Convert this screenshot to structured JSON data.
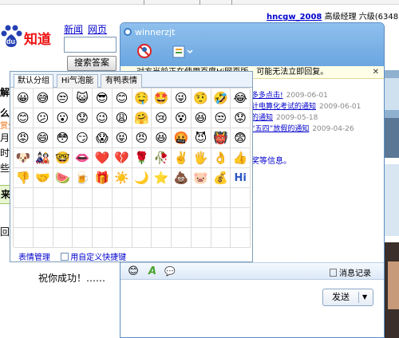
{
  "browser": {
    "user_link": "hncgw_2008",
    "user_rank": "高级经理 六级(6348)"
  },
  "baidu": {
    "logo_text": "知道",
    "nav": [
      "新闻",
      "网页"
    ],
    "search_button": "搜索答案",
    "fragments": {
      "f1": "解",
      "f2": "么",
      "f3": "赏分",
      "f4": "月百",
      "f5": "时候",
      "f6": "些给",
      "f7": "来",
      "f8": "回答"
    }
  },
  "picker": {
    "tabs": [
      "默认分组",
      "Hi气泡能",
      "有鸭表情"
    ],
    "emoticons": [
      [
        "😀",
        "😅",
        "😒",
        "😺",
        "😎",
        "😊",
        "🤤",
        "🤩",
        "😜",
        "🤨",
        "🤣",
        "😂"
      ],
      [
        "😊",
        "😕",
        "😮",
        "😟",
        "😉",
        "😩",
        "🤗",
        "😢",
        "😵",
        "😆",
        "😒",
        "😟"
      ],
      [
        "😡",
        "😄",
        "😳",
        "😏",
        "😱",
        "😝",
        "😠",
        "😆",
        "🤬",
        "😈",
        "👹",
        "😨"
      ],
      [
        "🐶",
        "🎎",
        "🤓",
        "👄",
        "❤️",
        "💔",
        "🌹",
        "🥀",
        "✌️",
        "🖐",
        "👌",
        "👍"
      ],
      [
        "👎",
        "🤝",
        "🍉",
        "🍺",
        "🎁",
        "☀️",
        "🌙",
        "⭐",
        "💩",
        "🐷",
        "💰",
        "Hi"
      ],
      [
        "",
        "",
        "",
        "",
        "",
        "",
        "",
        "",
        "",
        "",
        "",
        ""
      ],
      [
        "",
        "",
        "",
        "",
        "",
        "",
        "",
        "",
        "",
        "",
        "",
        ""
      ],
      [
        "",
        "",
        "",
        "",
        "",
        "",
        "",
        "",
        "",
        "",
        "",
        ""
      ]
    ],
    "footer": {
      "manage": "表情管理",
      "custom": "用自定义快捷键"
    }
  },
  "chat": {
    "title": "winnerzjt",
    "notice": "对方当前正在使用百度Hi网页版，可能无法立即回复。",
    "messages": [
      {
        "link": "多多点击!",
        "date": "2009-06-01"
      },
      {
        "link": "计电算化考试的通知",
        "date": "2009-06-01"
      },
      {
        "link": "的通知",
        "date": "2009-05-18"
      },
      {
        "link": "“五四”放假的通知",
        "date": "2009-04-26"
      }
    ],
    "extra": "奖等信息。",
    "history": "消息记录",
    "send": "发送",
    "composed": "祝你成功！……"
  }
}
